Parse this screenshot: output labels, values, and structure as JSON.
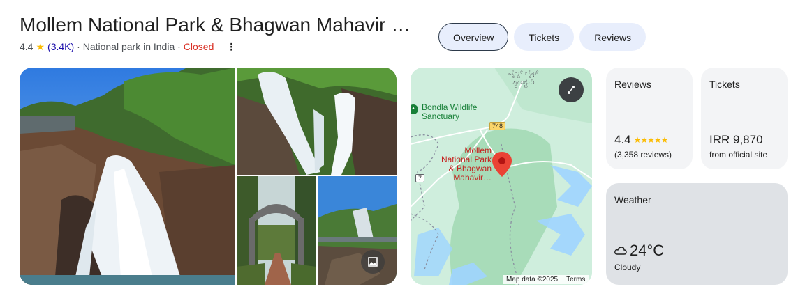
{
  "header": {
    "title": "Mollem National Park & Bhagwan Mahavir …",
    "rating": "4.4",
    "rating_count": "(3.4K)",
    "category": "· National park in India ·",
    "status": "Closed",
    "more_icon": "more-vert-icon"
  },
  "tabs": [
    {
      "label": "Overview",
      "active": true
    },
    {
      "label": "Tickets",
      "active": false
    },
    {
      "label": "Reviews",
      "active": false
    }
  ],
  "map": {
    "place_label_lines": [
      "Mollem",
      "National Park",
      "& Bhagwan",
      "Mahavir…"
    ],
    "nearby_label_lines": [
      "Bondla Wildlife",
      "Sanctuary"
    ],
    "kannada_label_lines": [
      "ವೈಲ್ಡ್ ಲೈಫ್",
      "ಸ್ಯಾಂಕ್ಚುರಿ"
    ],
    "road_748": "748",
    "road_7": "7",
    "attribution": "Map data ©2025",
    "terms": "Terms"
  },
  "cards": {
    "reviews": {
      "title": "Reviews",
      "rating": "4.4",
      "stars": 4.4,
      "count": "(3,358 reviews)"
    },
    "tickets": {
      "title": "Tickets",
      "price": "IRR 9,870",
      "source": "from official site"
    },
    "weather": {
      "title": "Weather",
      "temp": "24°C",
      "condition": "Cloudy",
      "icon": "cloud-icon"
    }
  },
  "colors": {
    "accent": "#1a0dab",
    "closed": "#d93025",
    "star": "#fbbc04",
    "pin": "#ea4335"
  }
}
